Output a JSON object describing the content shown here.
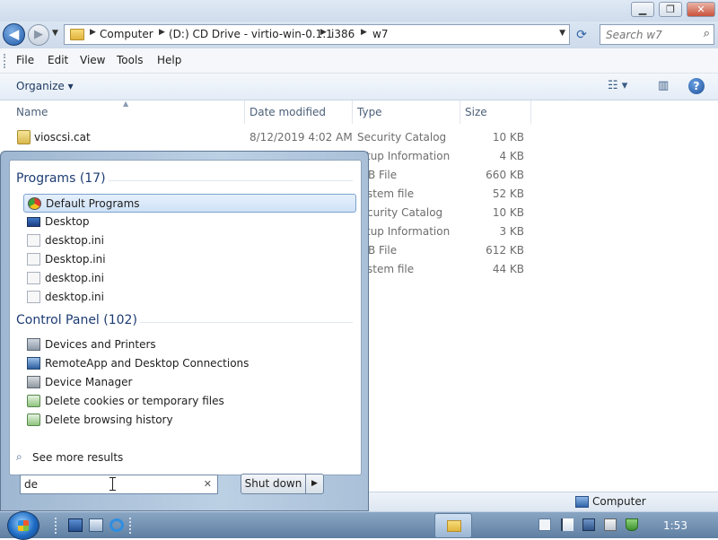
{
  "window": {
    "controls": {
      "minimize": "▁",
      "maximize": "❐",
      "close": "✕"
    }
  },
  "address": {
    "crumbs": [
      "Computer",
      "(D:) CD Drive - virtio-win-0.1.1",
      "i386",
      "w7"
    ],
    "search_placeholder": "Search w7"
  },
  "menu": [
    "File",
    "Edit",
    "View",
    "Tools",
    "Help"
  ],
  "toolbar": {
    "organize": "Organize ▾",
    "views_icon": "☷ ▾",
    "preview_icon": "▥",
    "help": "?"
  },
  "columns": {
    "name": "Name",
    "date": "Date modified",
    "type": "Type",
    "size": "Size"
  },
  "files": [
    {
      "name": "vioscsi.cat",
      "date": "8/12/2019 4:02 AM",
      "type": "Security Catalog",
      "size": "10 KB"
    },
    {
      "name": "",
      "date": "",
      "type": "tup Information",
      "size": "4 KB"
    },
    {
      "name": "",
      "date": "",
      "type": "B File",
      "size": "660 KB"
    },
    {
      "name": "",
      "date": "",
      "type": "stem file",
      "size": "52 KB"
    },
    {
      "name": "",
      "date": "",
      "type": "curity Catalog",
      "size": "10 KB"
    },
    {
      "name": "",
      "date": "",
      "type": "tup Information",
      "size": "3 KB"
    },
    {
      "name": "",
      "date": "",
      "type": "B File",
      "size": "612 KB"
    },
    {
      "name": "",
      "date": "",
      "type": "stem file",
      "size": "44 KB"
    }
  ],
  "statusbar": {
    "location": "Computer"
  },
  "startmenu": {
    "programs_header": "Programs (17)",
    "programs": [
      {
        "label": "Default Programs",
        "icon": "default-programs-icon"
      },
      {
        "label": "Desktop",
        "icon": "desktop-icon"
      },
      {
        "label": "desktop.ini",
        "icon": "ini-file-icon"
      },
      {
        "label": "Desktop.ini",
        "icon": "ini-file-icon"
      },
      {
        "label": "desktop.ini",
        "icon": "ini-file-icon"
      },
      {
        "label": "desktop.ini",
        "icon": "ini-file-icon"
      }
    ],
    "control_panel_header": "Control Panel (102)",
    "control_panel": [
      {
        "label": "Devices and Printers",
        "icon": "devices-printers-icon"
      },
      {
        "label": "RemoteApp and Desktop Connections",
        "icon": "remoteapp-icon"
      },
      {
        "label": "Device Manager",
        "icon": "device-manager-icon"
      },
      {
        "label": "Delete cookies or temporary files",
        "icon": "internet-options-icon"
      },
      {
        "label": "Delete browsing history",
        "icon": "internet-options-icon"
      }
    ],
    "see_more": "See more results",
    "search_value": "de",
    "clear": "✕",
    "shutdown": "Shut down",
    "shutdown_arrow": "▶"
  },
  "taskbar": {
    "clock": "1:53"
  },
  "colors": {
    "accent": "#1d3c73",
    "selection": "#cfe2f8",
    "taskbar": "#6f8db0"
  }
}
